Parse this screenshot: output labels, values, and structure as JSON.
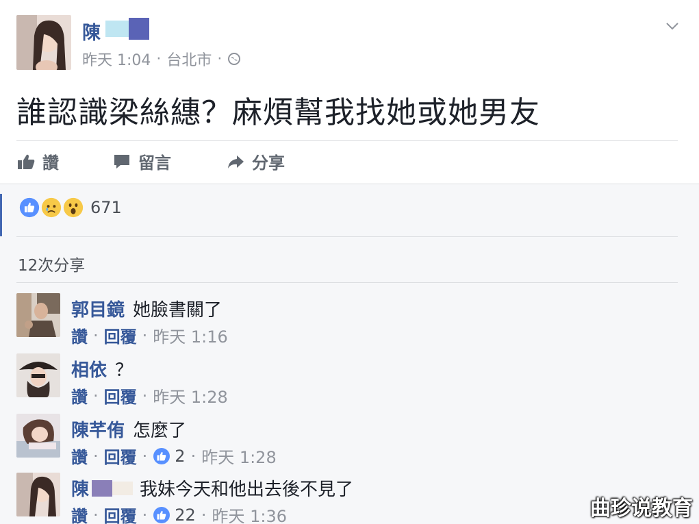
{
  "post": {
    "author": "陳",
    "time": "昨天 1:04",
    "location": "台北市",
    "separator": "·",
    "text": "誰認識梁絲繐？麻煩幫我找她或她男友",
    "actions": {
      "like": "讚",
      "comment": "留言",
      "share": "分享"
    }
  },
  "summary": {
    "reaction_count": "671",
    "reactions": [
      "like-icon",
      "sad-icon",
      "wow-icon"
    ],
    "shares": "12次分享"
  },
  "comments": [
    {
      "name": "郭目鏡",
      "text": "她臉書關了",
      "like": "讚",
      "reply": "回覆",
      "likes": "",
      "time": "昨天 1:16"
    },
    {
      "name": "相依",
      "text": "？",
      "like": "讚",
      "reply": "回覆",
      "likes": "",
      "time": "昨天 1:28"
    },
    {
      "name": "陳芊侑",
      "text": "怎麼了",
      "like": "讚",
      "reply": "回覆",
      "likes": "2",
      "time": "昨天 1:28"
    },
    {
      "name": "陳",
      "text": "我妹今天和他出去後不見了",
      "like": "讚",
      "reply": "回覆",
      "likes": "22",
      "time": "昨天 1:36"
    }
  ],
  "watermark": "曲珍说教育",
  "colors": {
    "link": "#365899",
    "accent": "#4267b2",
    "muted": "#90949c",
    "background": "#f6f7f9"
  }
}
